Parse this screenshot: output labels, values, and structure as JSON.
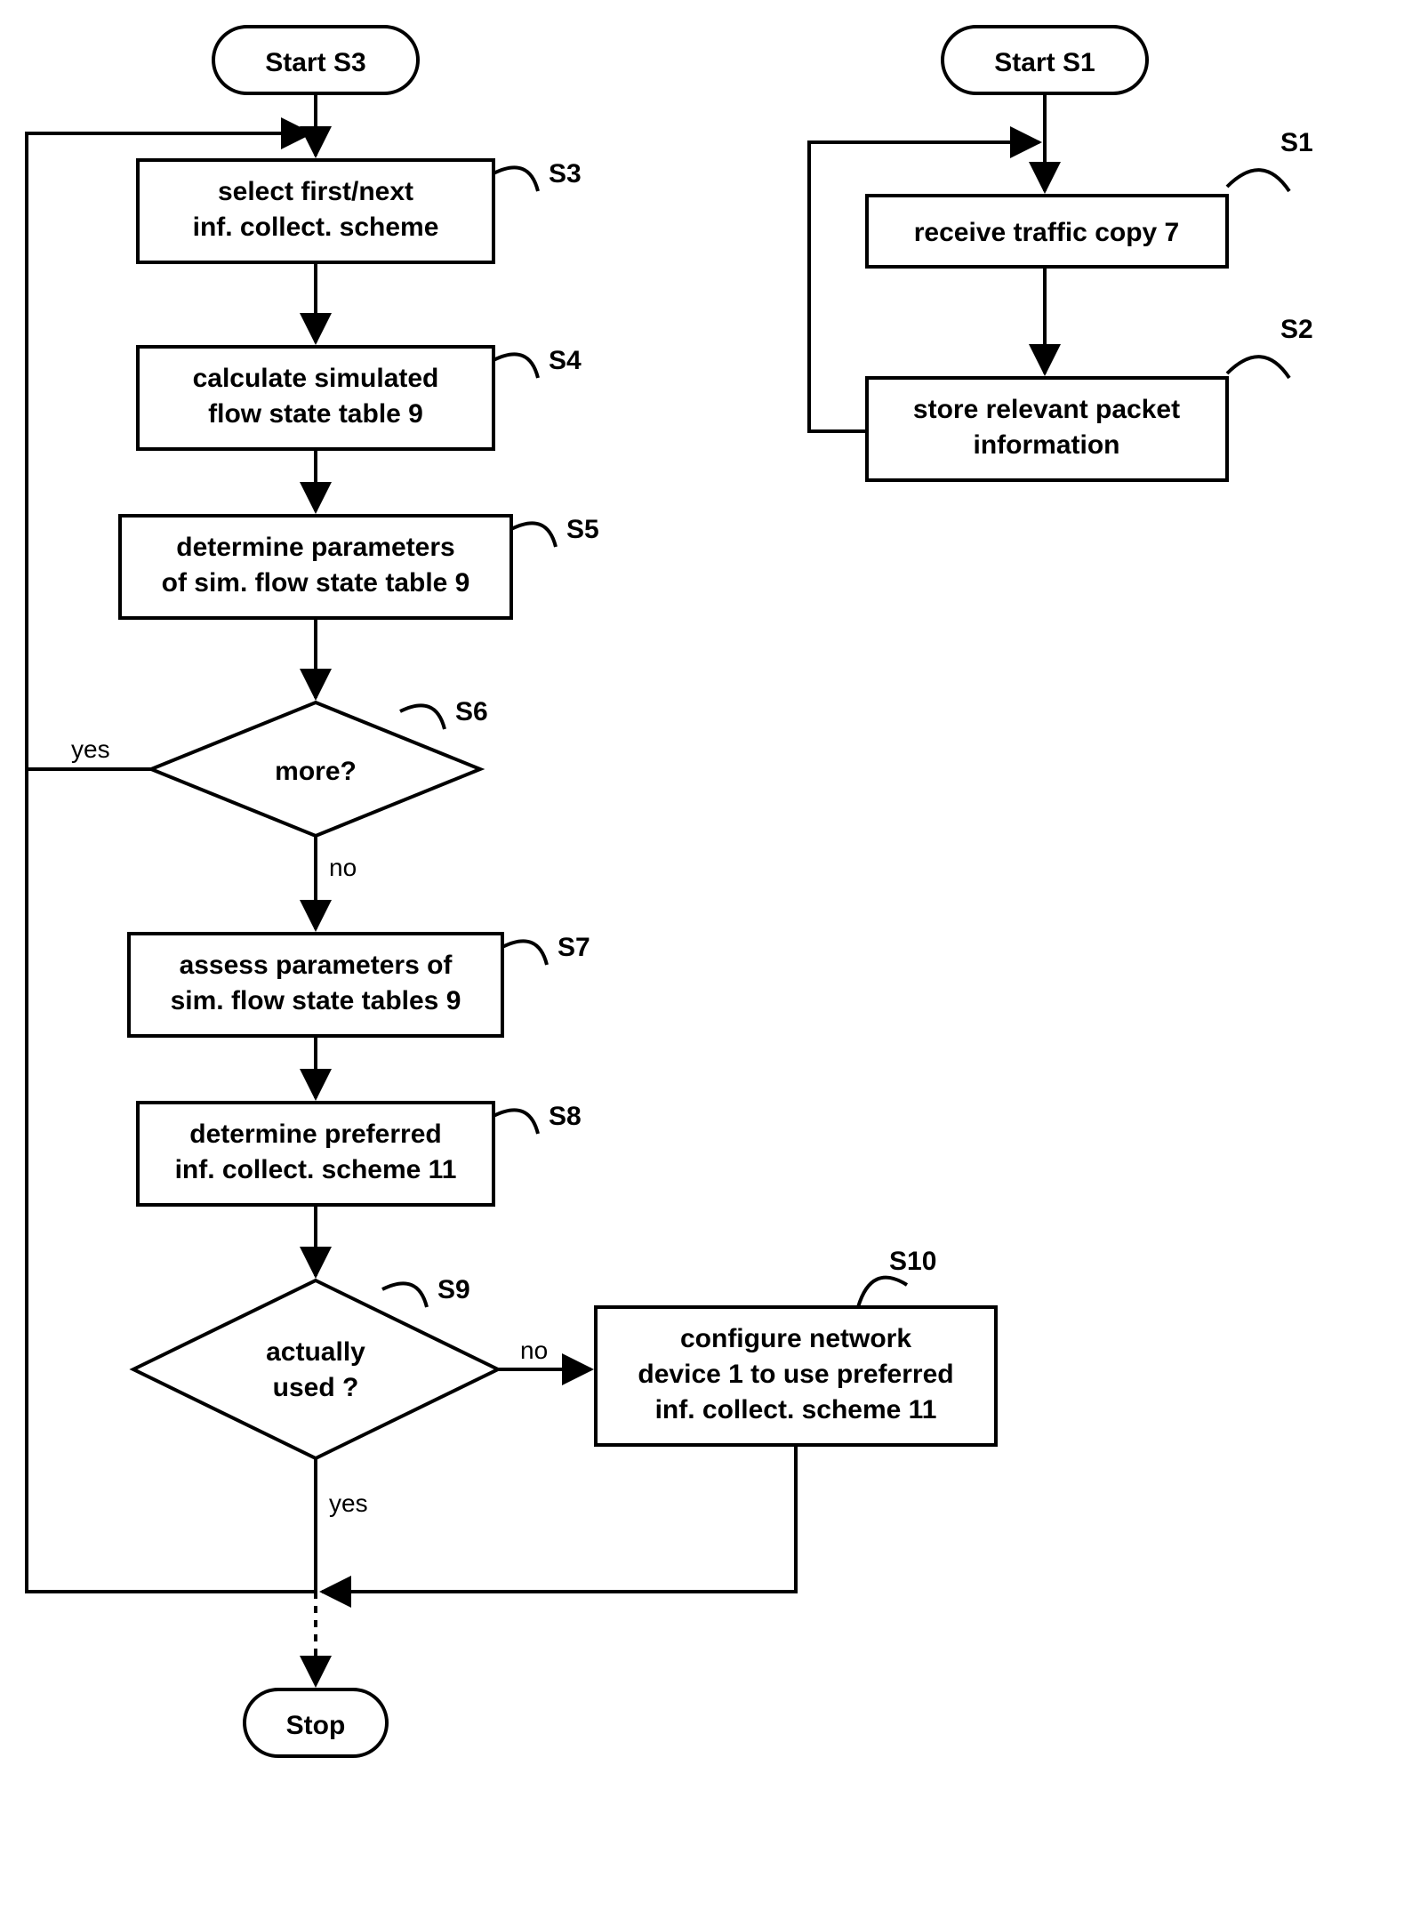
{
  "left": {
    "start": "Start S3",
    "s3": {
      "tag": "S3",
      "l1": "select first/next",
      "l2": "inf. collect. scheme"
    },
    "s4": {
      "tag": "S4",
      "l1": "calculate simulated",
      "l2": "flow state table 9"
    },
    "s5": {
      "tag": "S5",
      "l1": "determine parameters",
      "l2": "of sim. flow state table 9"
    },
    "s6": {
      "tag": "S6",
      "q": "more?",
      "yes": "yes",
      "no": "no"
    },
    "s7": {
      "tag": "S7",
      "l1": "assess parameters of",
      "l2": "sim. flow state tables 9"
    },
    "s8": {
      "tag": "S8",
      "l1": "determine preferred",
      "l2": "inf. collect. scheme 11"
    },
    "s9": {
      "tag": "S9",
      "l1": "actually",
      "l2": "used ?",
      "yes": "yes",
      "no": "no"
    },
    "s10": {
      "tag": "S10",
      "l1": "configure network",
      "l2": "device 1 to use  preferred",
      "l3": "inf. collect. scheme 11"
    },
    "stop": "Stop"
  },
  "right": {
    "start": "Start S1",
    "s1": {
      "tag": "S1",
      "l1": "receive traffic copy 7"
    },
    "s2": {
      "tag": "S2",
      "l1": "store relevant packet",
      "l2": "information"
    }
  }
}
